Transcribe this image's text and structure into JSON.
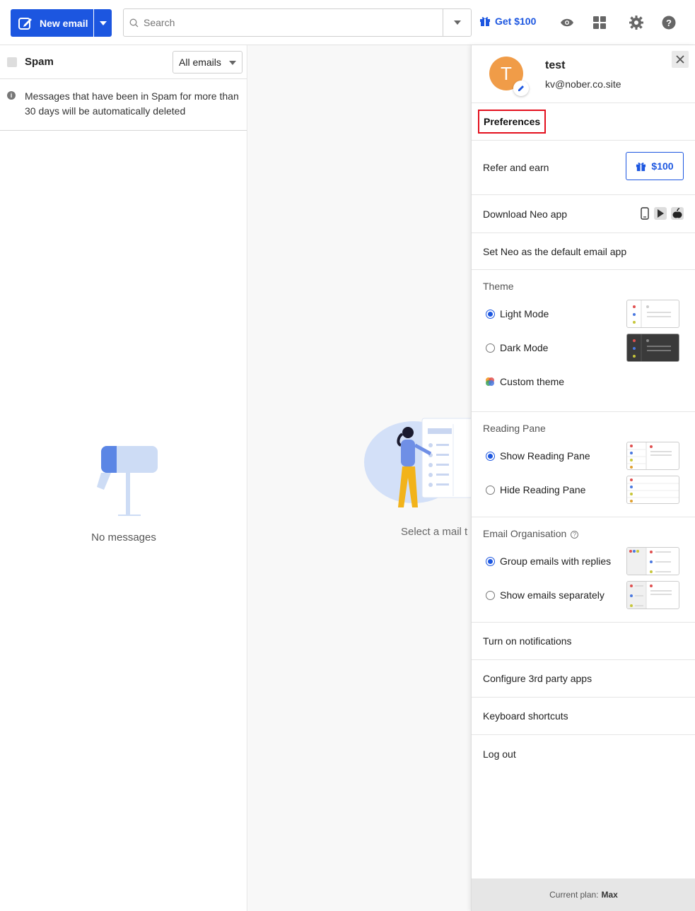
{
  "toolbar": {
    "new_email_label": "New email",
    "search_placeholder": "Search",
    "get100_label": "Get $100"
  },
  "folder": {
    "title": "Spam",
    "filter": "All emails",
    "notice": "Messages that have been in Spam for more than 30 days will be automatically deleted",
    "empty_label": "No messages"
  },
  "reading": {
    "placeholder": "Select a mail t"
  },
  "panel": {
    "name": "test",
    "avatar_letter": "T",
    "email": "kv@nober.co.site",
    "preferences": "Preferences",
    "refer_label": "Refer and earn",
    "refer_button": "$100",
    "download_label": "Download Neo app",
    "default_app": "Set Neo as the default email app",
    "theme": {
      "title": "Theme",
      "light": "Light Mode",
      "dark": "Dark Mode",
      "custom": "Custom theme",
      "selected": "Light Mode"
    },
    "reading_pane": {
      "title": "Reading Pane",
      "show": "Show Reading Pane",
      "hide": "Hide Reading Pane",
      "selected": "Show Reading Pane"
    },
    "email_org": {
      "title": "Email Organisation",
      "group": "Group emails with replies",
      "separate": "Show emails separately",
      "selected": "Group emails with replies"
    },
    "notifications": "Turn on notifications",
    "third_party": "Configure 3rd party apps",
    "shortcuts": "Keyboard shortcuts",
    "logout": "Log out",
    "plan_label": "Current plan:",
    "plan_value": "Max"
  },
  "colors": {
    "accent": "#1c56e0",
    "avatar": "#f09c48",
    "highlight_box": "#e3101d"
  }
}
